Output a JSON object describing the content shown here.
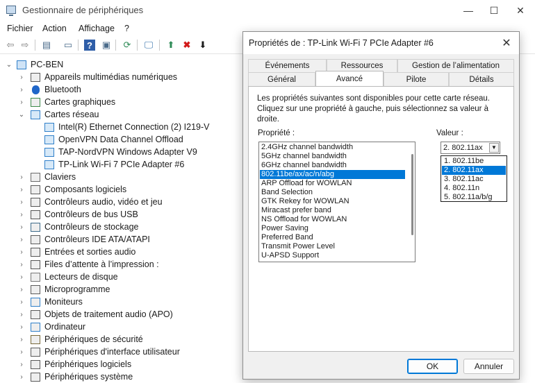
{
  "window": {
    "title": "Gestionnaire de périphériques",
    "minimize": "—",
    "maximize": "☐",
    "close": "✕"
  },
  "menu": [
    "Fichier",
    "Action",
    "Affichage",
    "?"
  ],
  "toolbar": {
    "icons": [
      "back-icon",
      "forward-icon",
      "view-icon",
      "properties-icon",
      "help-icon",
      "view2-icon",
      "scan-icon",
      "monitor-icon",
      "update-driver-icon",
      "uninstall-icon",
      "download-icon"
    ],
    "glyphs": [
      "⇦",
      "⇨",
      "▤",
      "▭",
      "?",
      "▣",
      "⟳",
      "🖵",
      "⬆",
      "✖",
      "⬇"
    ]
  },
  "tree": {
    "root": "PC-BEN",
    "items": [
      {
        "label": "Appareils multimédias numériques",
        "expander": "›",
        "icon": "multimedia-icon"
      },
      {
        "label": "Bluetooth",
        "expander": "›",
        "icon": "bluetooth-icon"
      },
      {
        "label": "Cartes graphiques",
        "expander": "›",
        "icon": "graphics-card-icon"
      },
      {
        "label": "Cartes réseau",
        "expander": "⌄",
        "icon": "network-adapter-icon"
      },
      {
        "label": "Intel(R) Ethernet Connection (2) I219-V",
        "expander": "",
        "icon": "network-adapter-icon",
        "child": true
      },
      {
        "label": "OpenVPN Data Channel Offload",
        "expander": "",
        "icon": "network-adapter-icon",
        "child": true
      },
      {
        "label": "TAP-NordVPN Windows Adapter V9",
        "expander": "",
        "icon": "network-adapter-icon",
        "child": true
      },
      {
        "label": "TP-Link Wi-Fi 7 PCIe Adapter #6",
        "expander": "",
        "icon": "network-adapter-icon",
        "child": true
      },
      {
        "label": "Claviers",
        "expander": "›",
        "icon": "keyboard-icon"
      },
      {
        "label": "Composants logiciels",
        "expander": "›",
        "icon": "software-component-icon"
      },
      {
        "label": "Contrôleurs audio, vidéo et jeu",
        "expander": "›",
        "icon": "audio-icon"
      },
      {
        "label": "Contrôleurs de bus USB",
        "expander": "›",
        "icon": "usb-icon"
      },
      {
        "label": "Contrôleurs de stockage",
        "expander": "›",
        "icon": "storage-icon"
      },
      {
        "label": "Contrôleurs IDE ATA/ATAPI",
        "expander": "›",
        "icon": "ide-icon"
      },
      {
        "label": "Entrées et sorties audio",
        "expander": "›",
        "icon": "speaker-icon"
      },
      {
        "label": "Files d’attente à l’impression :",
        "expander": "›",
        "icon": "printer-icon"
      },
      {
        "label": "Lecteurs de disque",
        "expander": "›",
        "icon": "disk-icon"
      },
      {
        "label": "Microprogramme",
        "expander": "›",
        "icon": "firmware-icon"
      },
      {
        "label": "Moniteurs",
        "expander": "›",
        "icon": "monitor-icon"
      },
      {
        "label": "Objets de traitement audio (APO)",
        "expander": "›",
        "icon": "apo-icon"
      },
      {
        "label": "Ordinateur",
        "expander": "›",
        "icon": "computer-icon"
      },
      {
        "label": "Périphériques de sécurité",
        "expander": "›",
        "icon": "security-icon"
      },
      {
        "label": "Périphériques d'interface utilisateur",
        "expander": "›",
        "icon": "hid-icon"
      },
      {
        "label": "Périphériques logiciels",
        "expander": "›",
        "icon": "software-device-icon"
      },
      {
        "label": "Périphériques système",
        "expander": "›",
        "icon": "system-device-icon"
      }
    ]
  },
  "dialog": {
    "title": "Propriétés de : TP-Link Wi-Fi 7 PCIe Adapter #6",
    "close": "✕",
    "tabs_top": [
      "Événements",
      "Ressources",
      "Gestion de l’alimentation"
    ],
    "tabs_bottom": [
      "Général",
      "Avancé",
      "Pilote",
      "Détails"
    ],
    "active_tab": "Avancé",
    "description": "Les propriétés suivantes sont disponibles pour cette carte réseau. Cliquez sur une propriété à gauche, puis sélectionnez sa valeur à droite.",
    "property_label": "Propriété :",
    "value_label": "Valeur :",
    "properties": [
      "2.4GHz channel bandwidth",
      "5GHz channel bandwidth",
      "6GHz channel bandwidth",
      "802.11be/ax/ac/n/abg",
      "ARP Offload for WOWLAN",
      "Band Selection",
      "GTK Rekey for WOWLAN",
      "Miracast prefer band",
      "NS Offload for WOWLAN",
      "Power Saving",
      "Preferred Band",
      "Transmit Power Level",
      "U-APSD Support"
    ],
    "selected_property": "802.11be/ax/ac/n/abg",
    "value_selected": "2. 802.11ax",
    "value_options": [
      "1. 802.11be",
      "2. 802.11ax",
      "3. 802.11ac",
      "4. 802.11n",
      "5. 802.11a/b/g"
    ],
    "ok": "OK",
    "cancel": "Annuler"
  },
  "colors": {
    "selection": "#0078d7",
    "dialog_bg": "#f0f0f0",
    "panel_bg": "#ffffff"
  }
}
